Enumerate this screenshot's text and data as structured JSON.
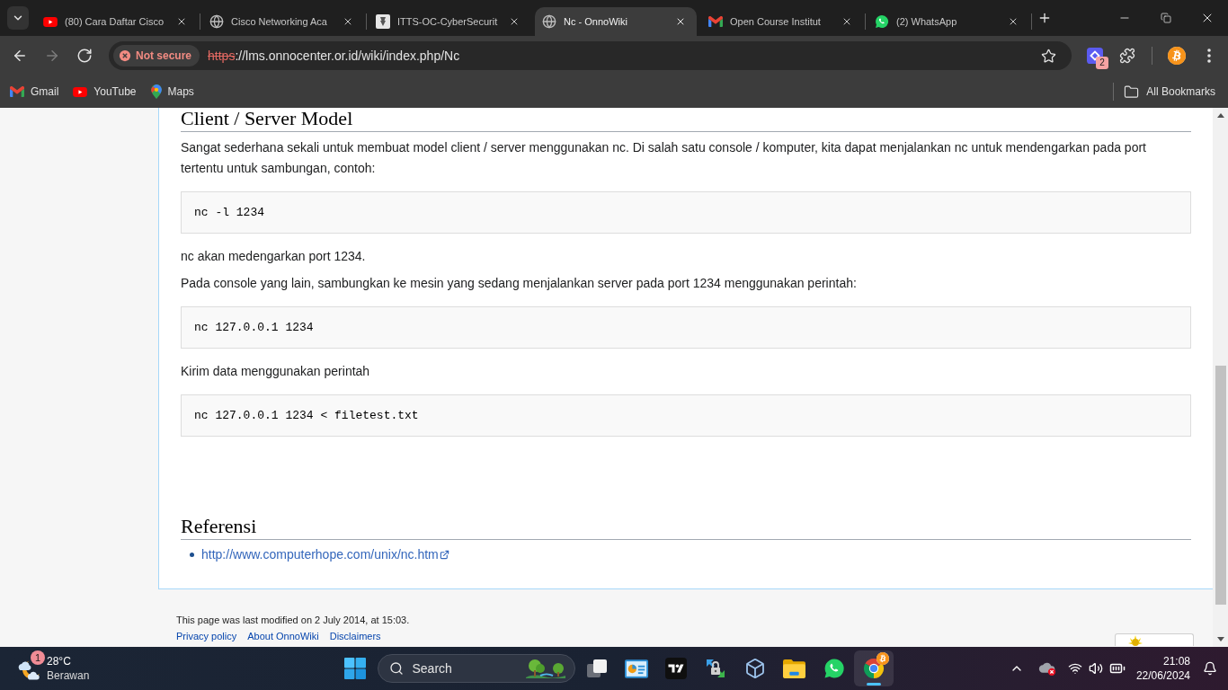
{
  "browser": {
    "tabs": [
      {
        "title": "(80) Cara Daftar Cisco",
        "kind": "video",
        "selected": false
      },
      {
        "title": "Cisco Networking Aca",
        "kind": "globe",
        "selected": false
      },
      {
        "title": "ITTS-OC-CyberSecurit",
        "kind": "tile",
        "selected": false
      },
      {
        "title": "Nc - OnnoWiki",
        "kind": "globe",
        "selected": true
      },
      {
        "title": "Open Course Institut",
        "kind": "mail",
        "selected": false
      },
      {
        "title": "(2) WhatsApp",
        "kind": "chat",
        "selected": false
      }
    ],
    "navigation": [
      {
        "kind": "back",
        "disabled": false
      },
      {
        "kind": "forward",
        "disabled": true
      },
      {
        "kind": "reload",
        "disabled": false
      }
    ],
    "address_bar": {
      "security_chip": "Not secure",
      "scheme": "https",
      "url_rest": "://lms.onnocenter.or.id/wiki/index.php/Nc"
    },
    "extension_badge": "2",
    "bookmarks": [
      {
        "label": "Gmail",
        "kind": "mail"
      },
      {
        "label": "YouTube",
        "kind": "video"
      },
      {
        "label": "Maps",
        "kind": "map"
      }
    ],
    "all_bookmarks": "All Bookmarks"
  },
  "page": {
    "sections": [
      {
        "heading": "Client / Server Model",
        "blocks": [
          {
            "kind": "paragraph",
            "text": "Sangat sederhana sekali untuk membuat model client / server menggunakan nc. Di salah satu console / komputer, kita dapat menjalankan nc untuk mendengarkan pada port tertentu untuk sambungan, contoh:"
          },
          {
            "kind": "code",
            "text": "nc -l 1234"
          },
          {
            "kind": "paragraph",
            "text": "nc akan medengarkan port 1234."
          },
          {
            "kind": "paragraph",
            "text": "Pada console yang lain, sambungkan ke mesin yang sedang menjalankan server pada port 1234 menggunakan perintah:"
          },
          {
            "kind": "code",
            "text": "nc 127.0.0.1 1234"
          },
          {
            "kind": "paragraph",
            "text": "Kirim data menggunakan perintah"
          },
          {
            "kind": "code",
            "text": "nc 127.0.0.1 1234 < filetest.txt"
          }
        ]
      },
      {
        "heading": "Referensi",
        "blocks": [
          {
            "kind": "list",
            "items": [
              {
                "text": "http://www.computerhope.com/unix/nc.htm",
                "external": true
              }
            ]
          }
        ]
      }
    ],
    "footer": {
      "last_modified": "This page was last modified on 2 July 2014, at 15:03.",
      "links": [
        "Privacy policy",
        "About OnnoWiki",
        "Disclaimers"
      ]
    }
  },
  "taskbar": {
    "weather": {
      "badge": "1",
      "temperature": "28°C",
      "condition": "Berawan"
    },
    "search": {
      "placeholder": "Search"
    },
    "apps": [
      {
        "kind": "dashboard",
        "active": false
      },
      {
        "kind": "logo",
        "active": false
      },
      {
        "kind": "lock",
        "active": false
      },
      {
        "kind": "cube",
        "active": false
      },
      {
        "kind": "folder",
        "active": false
      },
      {
        "kind": "chat",
        "active": false
      },
      {
        "kind": "browser",
        "active": true
      }
    ],
    "time": "21:08",
    "date": "22/06/2024"
  }
}
